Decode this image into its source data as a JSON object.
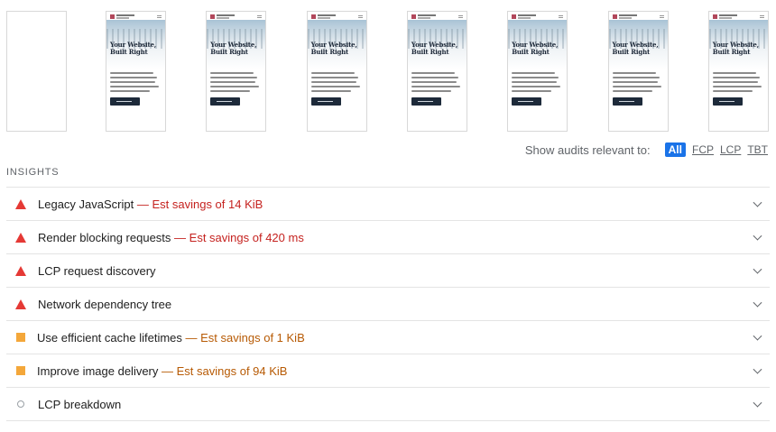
{
  "filmstrip": {
    "frames": [
      {
        "state": "blank"
      },
      {
        "title_line1": "Your Website,",
        "title_line2": "Built Right"
      },
      {
        "title_line1": "Your Website,",
        "title_line2": "Built Right"
      },
      {
        "title_line1": "Your Website,",
        "title_line2": "Built Right"
      },
      {
        "title_line1": "Your Website,",
        "title_line2": "Built Right"
      },
      {
        "title_line1": "Your Website,",
        "title_line2": "Built Right"
      },
      {
        "title_line1": "Your Website,",
        "title_line2": "Built Right"
      },
      {
        "title_line1": "Your Website,",
        "title_line2": "Built Right"
      }
    ]
  },
  "filter": {
    "label": "Show audits relevant to:",
    "chips": [
      "All",
      "FCP",
      "LCP",
      "TBT"
    ],
    "active": "All",
    "accent": "#1a73e8"
  },
  "insights": {
    "section_title": "INSIGHTS",
    "items": [
      {
        "status": "fail",
        "icon": "red-triangle-icon",
        "title": "Legacy JavaScript",
        "savings": "— Est savings of 14 KiB"
      },
      {
        "status": "fail",
        "icon": "red-triangle-icon",
        "title": "Render blocking requests",
        "savings": "— Est savings of 420 ms"
      },
      {
        "status": "fail",
        "icon": "red-triangle-icon",
        "title": "LCP request discovery",
        "savings": ""
      },
      {
        "status": "fail",
        "icon": "red-triangle-icon",
        "title": "Network dependency tree",
        "savings": ""
      },
      {
        "status": "warn",
        "icon": "orange-square-icon",
        "title": "Use efficient cache lifetimes",
        "savings": "— Est savings of 1 KiB"
      },
      {
        "status": "warn",
        "icon": "orange-square-icon",
        "title": "Improve image delivery",
        "savings": "— Est savings of 94 KiB"
      },
      {
        "status": "info",
        "icon": "gray-circle-icon",
        "title": "LCP breakdown",
        "savings": ""
      }
    ],
    "colors": {
      "fail": "#e53935",
      "warn": "#f4a73a",
      "info": "#9aa0a6"
    }
  }
}
